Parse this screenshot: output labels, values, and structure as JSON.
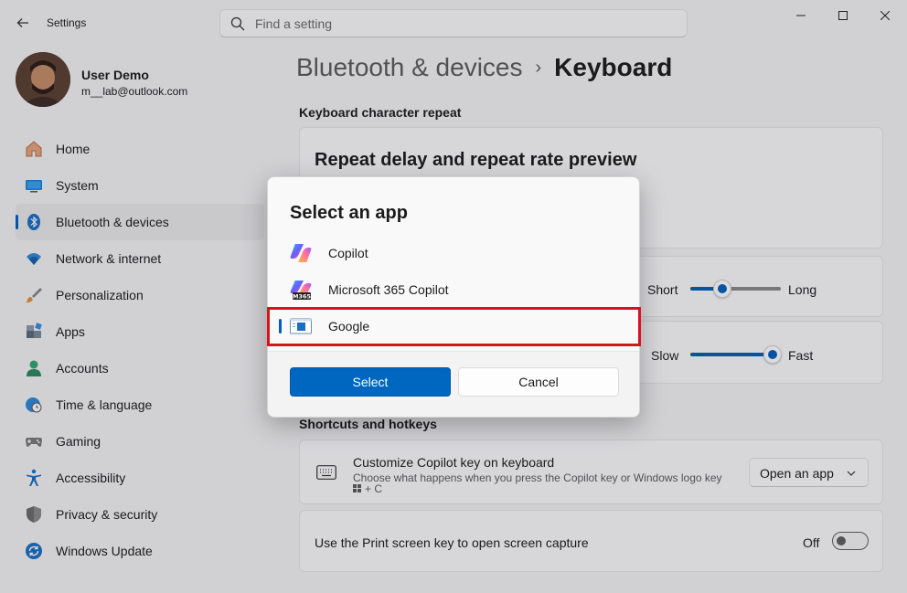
{
  "window": {
    "title": "Settings",
    "search_placeholder": "Find a setting"
  },
  "profile": {
    "name": "User Demo",
    "email": "m__lab@outlook.com"
  },
  "sidebar": {
    "items": [
      {
        "label": "Home",
        "icon": "home-icon"
      },
      {
        "label": "System",
        "icon": "system-icon"
      },
      {
        "label": "Bluetooth & devices",
        "icon": "bluetooth-icon",
        "active": true
      },
      {
        "label": "Network & internet",
        "icon": "wifi-icon"
      },
      {
        "label": "Personalization",
        "icon": "brush-icon"
      },
      {
        "label": "Apps",
        "icon": "apps-icon"
      },
      {
        "label": "Accounts",
        "icon": "person-icon"
      },
      {
        "label": "Time & language",
        "icon": "globe-clock-icon"
      },
      {
        "label": "Gaming",
        "icon": "gamepad-icon"
      },
      {
        "label": "Accessibility",
        "icon": "accessibility-icon"
      },
      {
        "label": "Privacy & security",
        "icon": "shield-icon"
      },
      {
        "label": "Windows Update",
        "icon": "update-icon"
      }
    ]
  },
  "breadcrumb": {
    "parent": "Bluetooth & devices",
    "separator": "›",
    "current": "Keyboard"
  },
  "repeat_section": {
    "title": "Keyboard character repeat",
    "preview_heading": "Repeat delay and repeat rate preview",
    "delay": {
      "min_label": "Short",
      "max_label": "Long",
      "value": 0.45
    },
    "rate": {
      "min_label": "Slow",
      "max_label": "Fast",
      "value": 1.0
    }
  },
  "shortcuts_section": {
    "title": "Shortcuts and hotkeys",
    "copilot_key": {
      "title": "Customize Copilot key on keyboard",
      "desc_line1": "Choose what happens when you press the Copilot key or Windows logo key",
      "desc_line2": "+ C",
      "dropdown_value": "Open an app"
    },
    "print_screen": {
      "title": "Use the Print screen key to open screen capture",
      "state": "Off"
    }
  },
  "dialog": {
    "title": "Select an app",
    "apps": [
      {
        "label": "Copilot",
        "icon": "copilot-icon"
      },
      {
        "label": "Microsoft 365 Copilot",
        "icon": "m365-copilot-icon"
      },
      {
        "label": "Google",
        "icon": "google-app-icon",
        "selected": true
      }
    ],
    "select_label": "Select",
    "cancel_label": "Cancel",
    "colors": {
      "accent": "#0067c0",
      "highlight": "#d8141a"
    }
  }
}
